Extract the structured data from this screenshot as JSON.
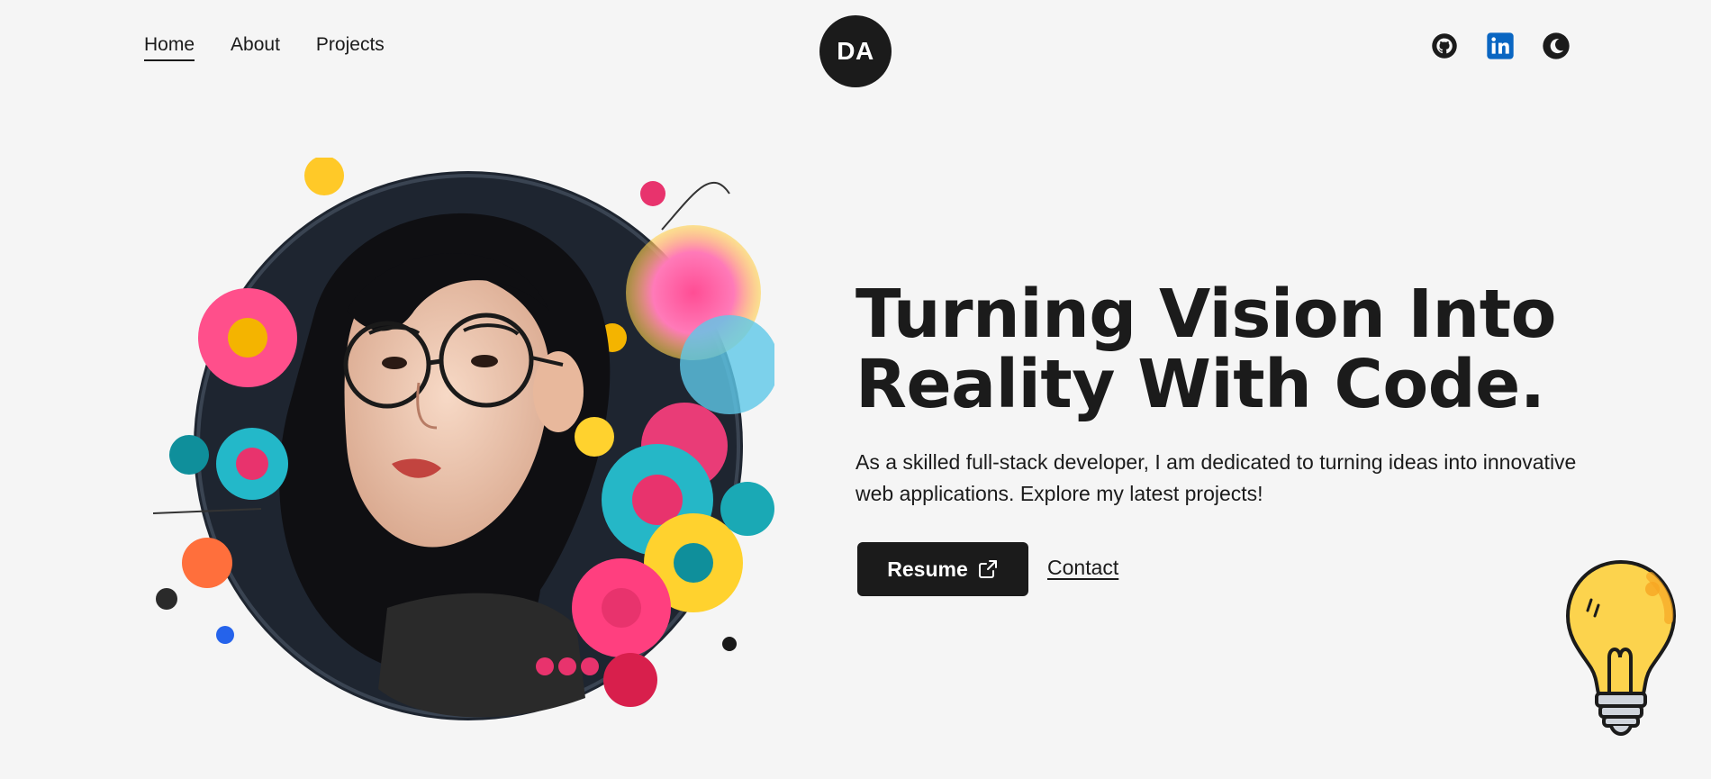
{
  "nav": {
    "links": [
      {
        "label": "Home",
        "active": true
      },
      {
        "label": "About",
        "active": false
      },
      {
        "label": "Projects",
        "active": false
      }
    ],
    "logo_text": "DA",
    "social_icons": [
      "github-icon",
      "linkedin-icon",
      "moon-icon"
    ]
  },
  "hero": {
    "headline_line1": "Turning Vision Into",
    "headline_line2": "Reality With Code.",
    "intro": "As a skilled full-stack developer, I am dedicated to turning ideas into innovative web applications. Explore my latest projects!",
    "resume_label": "Resume",
    "contact_label": "Contact"
  },
  "colors": {
    "background": "#f5f5f5",
    "text": "#1b1b1b",
    "linkedin": "#0a66c2",
    "bulb": "#fcd34d"
  }
}
